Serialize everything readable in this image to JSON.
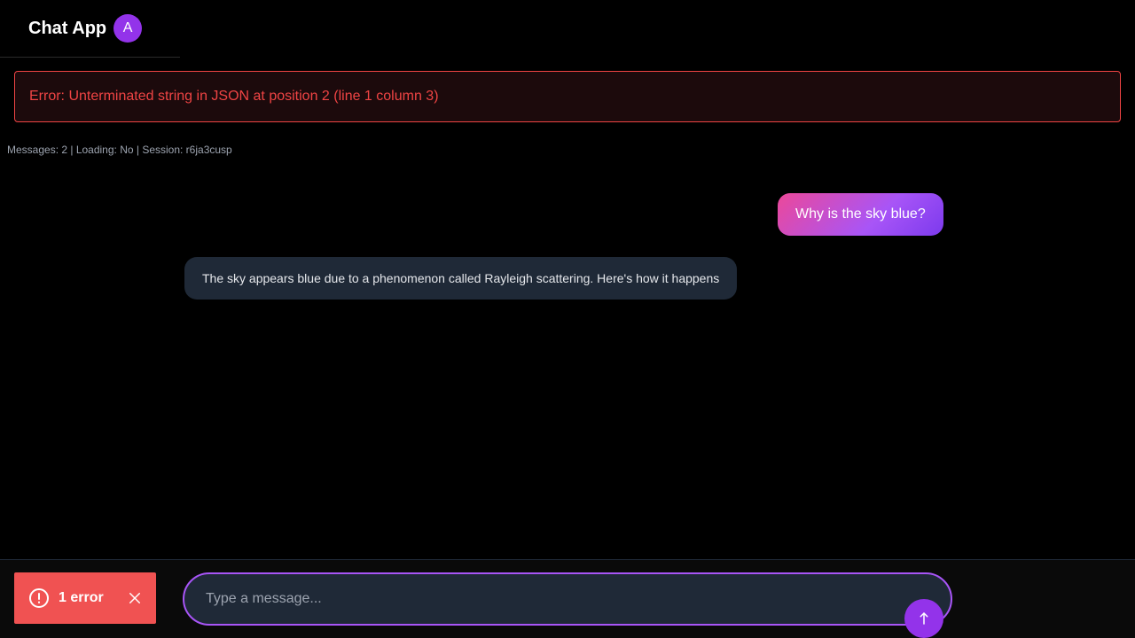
{
  "header": {
    "title": "Chat App",
    "avatar_initial": "A"
  },
  "error_banner": {
    "text": "Error: Unterminated string in JSON at position 2 (line 1 column 3)"
  },
  "status_line": "Messages: 2 | Loading: No | Session: r6ja3cusp",
  "messages": [
    {
      "role": "user",
      "text": "Why is the sky blue?"
    },
    {
      "role": "assistant",
      "text": "The sky appears blue due to a phenomenon called Rayleigh scattering. Here's how it happens"
    }
  ],
  "error_toast": {
    "label": "1 error",
    "icon": "alert-circle-icon",
    "close_icon": "close-icon"
  },
  "composer": {
    "placeholder": "Type a message...",
    "value": "",
    "send_icon": "arrow-up-icon"
  },
  "colors": {
    "accent": "#9333ea",
    "error": "#ef4444",
    "toast": "#f05252",
    "user_bubble_start": "#ec4899",
    "user_bubble_end": "#7c3aed",
    "assistant_bubble": "#1f2937"
  }
}
